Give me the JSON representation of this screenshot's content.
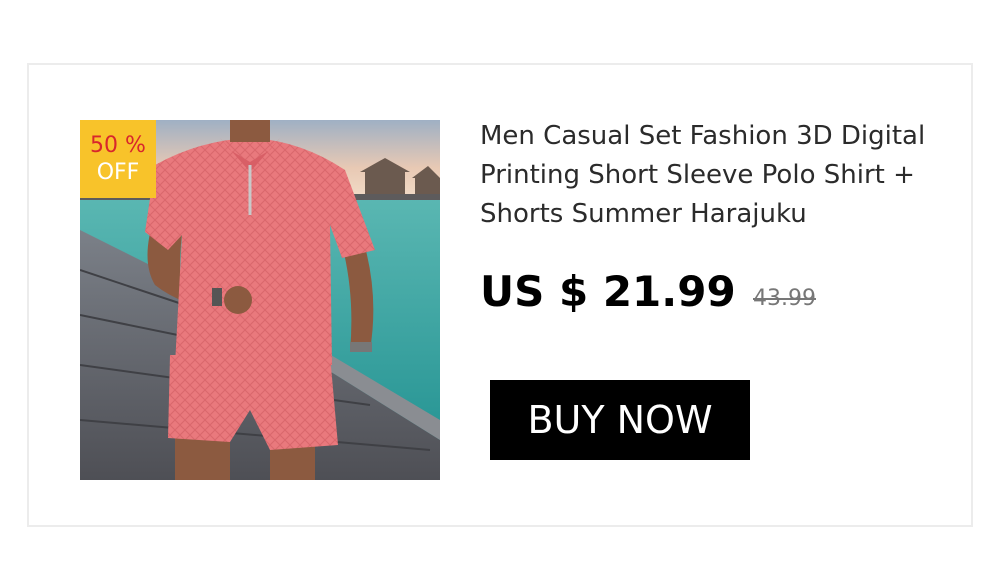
{
  "product": {
    "title": "Men Casual Set Fashion 3D Digital Printing Short Sleeve Polo Shirt + Shorts Summer Harajuku",
    "price": "US $ 21.99",
    "original_price": "43.99",
    "badge": {
      "percent": "50 %",
      "off": "OFF",
      "color": "#f8c32a",
      "percent_color": "#d8262c"
    },
    "image": "pink-polo-and-shorts-set-on-pier-photo"
  },
  "actions": {
    "buy_label": "BUY NOW"
  },
  "colors": {
    "accent": "#000000",
    "garment": "#e9797d"
  }
}
